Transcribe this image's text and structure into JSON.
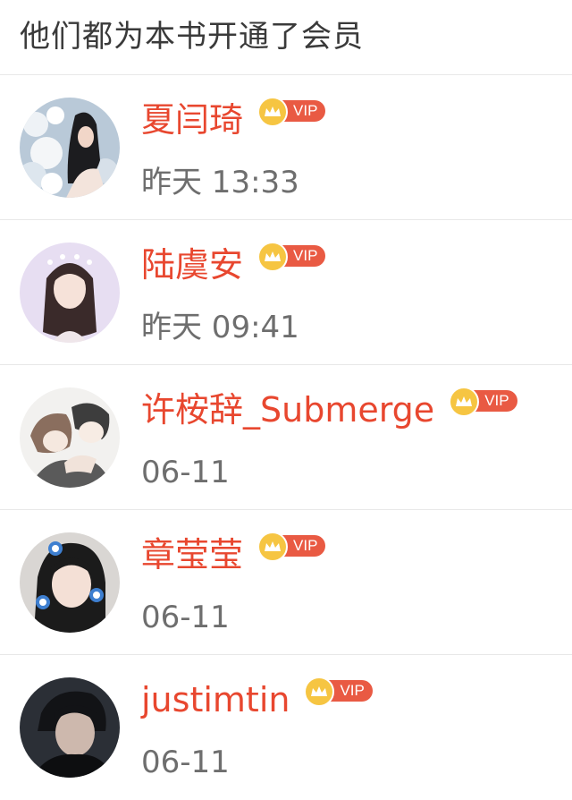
{
  "header": {
    "title": "他们都为本书开通了会员"
  },
  "members": [
    {
      "name": "夏闫琦",
      "badge": "VIP",
      "time": "昨天 13:33",
      "avatar_icon": "avatar-girl-flowers"
    },
    {
      "name": "陆虞安",
      "badge": "VIP",
      "time": "昨天 09:41",
      "avatar_icon": "avatar-girl-stars"
    },
    {
      "name": "许桉辞_Submerge",
      "badge": "VIP",
      "time": "06-11",
      "avatar_icon": "avatar-drawn-couple"
    },
    {
      "name": "章莹莹",
      "badge": "VIP",
      "time": "06-11",
      "avatar_icon": "avatar-girl-smurfs"
    },
    {
      "name": "justimtin",
      "badge": "VIP",
      "time": "06-11",
      "avatar_icon": "avatar-boy-dark"
    }
  ],
  "colors": {
    "name": "#e8472f",
    "vip_pill": "#e95a43",
    "vip_crown": "#f6c542",
    "time": "#6e6e6e",
    "divider": "#e8e8e8"
  }
}
